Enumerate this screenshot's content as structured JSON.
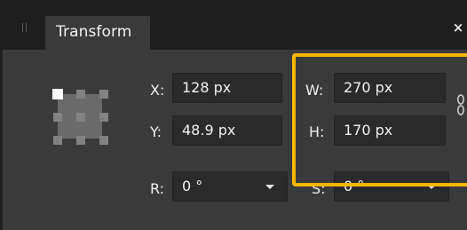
{
  "panel": {
    "tab_label": "Transform",
    "close_glyph": "×"
  },
  "fields": {
    "x": {
      "label": "X:",
      "value": "128 px"
    },
    "y": {
      "label": "Y:",
      "value": "48.9 px"
    },
    "w": {
      "label": "W:",
      "value": "270 px"
    },
    "h": {
      "label": "H:",
      "value": "170 px"
    },
    "r": {
      "label": "R:",
      "value": "0 °"
    },
    "s": {
      "label": "S:",
      "value": "0 °"
    }
  },
  "colors": {
    "highlight": "#f7b500",
    "panel_bg": "#3a3a3a",
    "field_bg": "#2a2a2a"
  },
  "icons": {
    "anchor_selector": "anchor-grid-icon",
    "link": "chain-link-icon",
    "close": "close-icon"
  }
}
